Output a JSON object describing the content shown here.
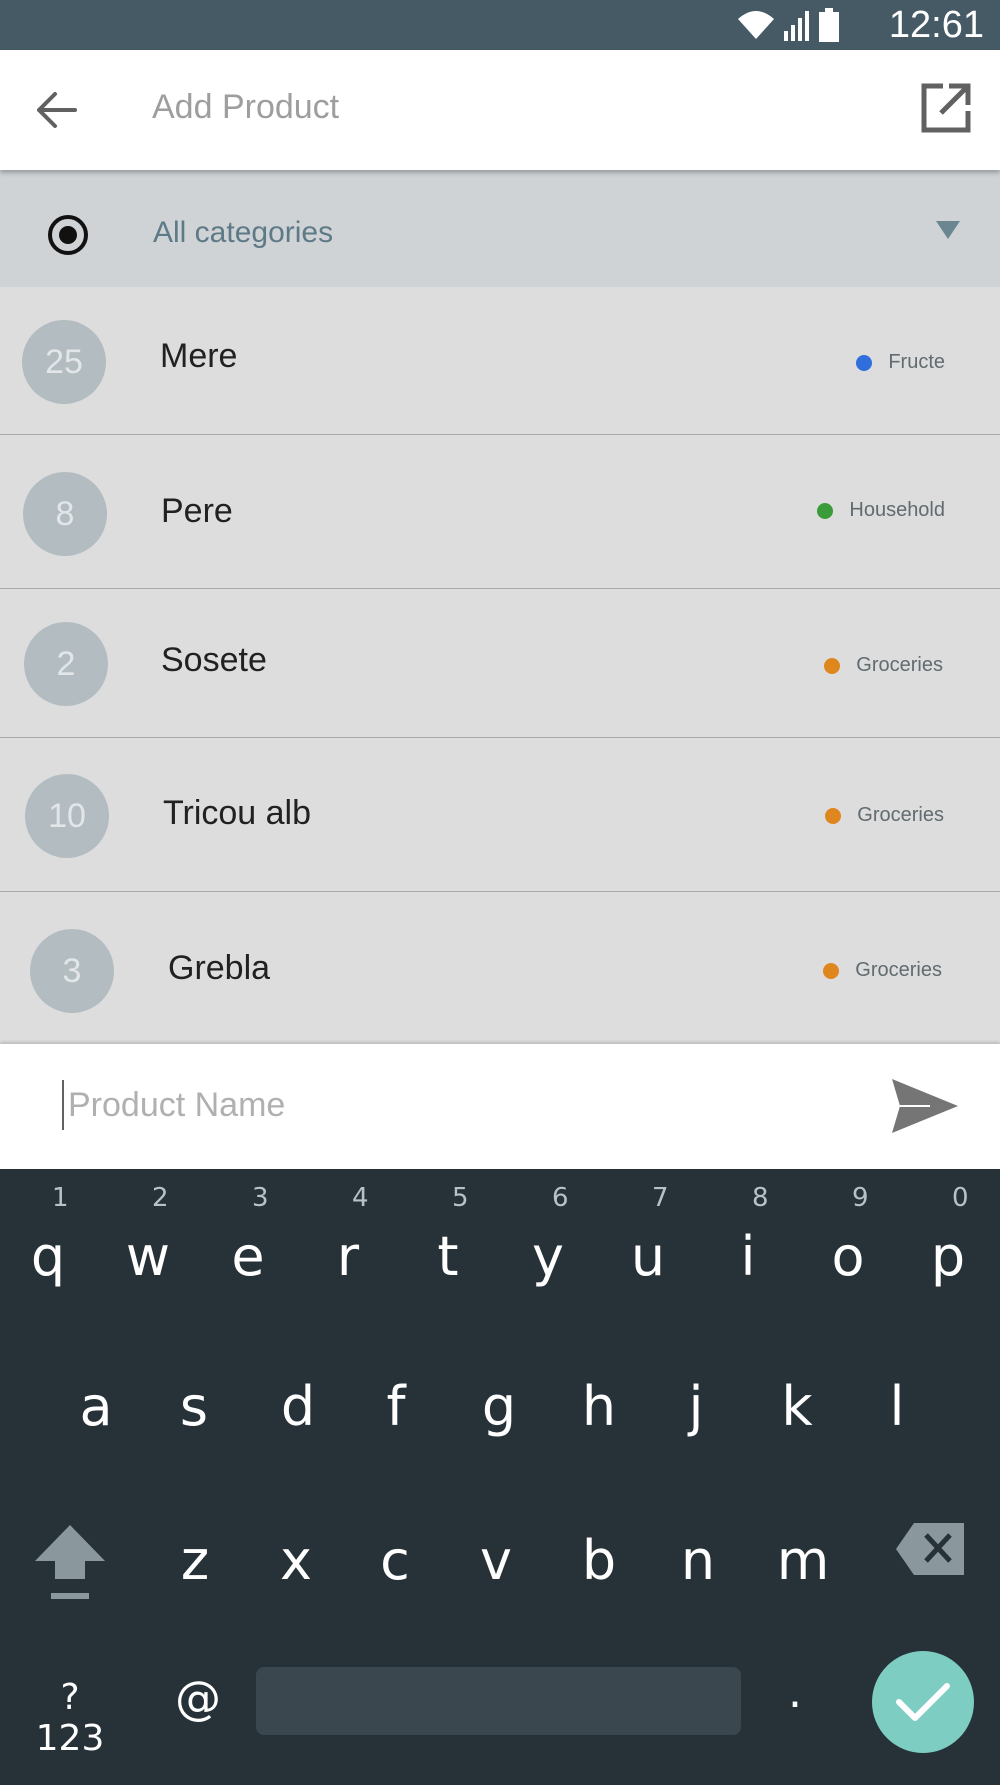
{
  "status_bar": {
    "time": "12:61"
  },
  "app_bar": {
    "title": "Add Product",
    "back_icon": "arrow-back-icon",
    "open_icon": "open-in-new-icon"
  },
  "filter": {
    "label": "All categories"
  },
  "products": [
    {
      "qty": "25",
      "name": "Mere",
      "category": "Fructe",
      "color": "#2f6fdc"
    },
    {
      "qty": "8",
      "name": "Pere",
      "category": "Household",
      "color": "#3a9b3a"
    },
    {
      "qty": "2",
      "name": "Sosete",
      "category": "Groceries",
      "color": "#e0861f"
    },
    {
      "qty": "10",
      "name": "Tricou alb",
      "category": "Groceries",
      "color": "#e0861f"
    },
    {
      "qty": "3",
      "name": "Grebla",
      "category": "Groceries",
      "color": "#e0861f"
    }
  ],
  "input": {
    "placeholder": "Product Name",
    "value": ""
  },
  "keyboard": {
    "row1": [
      "q",
      "w",
      "e",
      "r",
      "t",
      "y",
      "u",
      "i",
      "o",
      "p"
    ],
    "row1_hints": [
      "1",
      "2",
      "3",
      "4",
      "5",
      "6",
      "7",
      "8",
      "9",
      "0"
    ],
    "row2": [
      "a",
      "s",
      "d",
      "f",
      "g",
      "h",
      "j",
      "k",
      "l"
    ],
    "row3": [
      "z",
      "x",
      "c",
      "v",
      "b",
      "n",
      "m"
    ],
    "symbols": "?123",
    "at": "@",
    "period": "."
  },
  "colors": {
    "status_bar": "#455a64",
    "keyboard": "#263238",
    "enter": "#7ecdc3"
  }
}
